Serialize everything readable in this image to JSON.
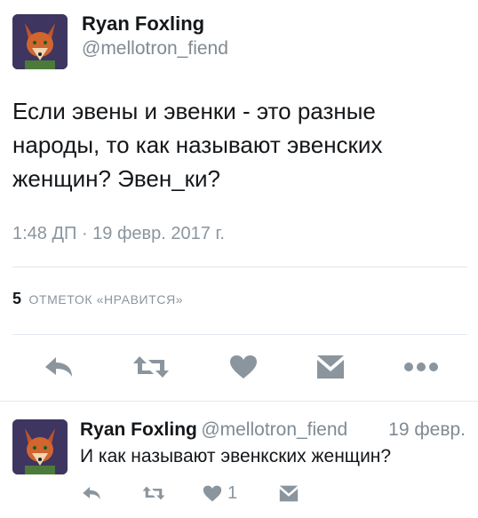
{
  "tweet": {
    "author_name": "Ryan Foxling",
    "author_handle": "@mellotron_fiend",
    "text_lines": [
      "Если эвены и эвенки - это разные",
      "народы, то как называют эвенских",
      "женщин? Эвен_ки?"
    ],
    "timestamp": "1:48 ДП · 19 февр. 2017 г.",
    "likes_count": "5",
    "likes_label": "ОТМЕТОК «НРАВИТСЯ»"
  },
  "actions": {
    "icons": [
      "reply-icon",
      "retweet-icon",
      "heart-icon",
      "dm-icon",
      "more-icon"
    ],
    "color": "#8a959e"
  },
  "reply": {
    "author_name": "Ryan Foxling",
    "author_handle": "@mellotron_fiend",
    "date": "19 февр.",
    "text": "И как называют эвенкских женщин?",
    "like_count": "1"
  }
}
